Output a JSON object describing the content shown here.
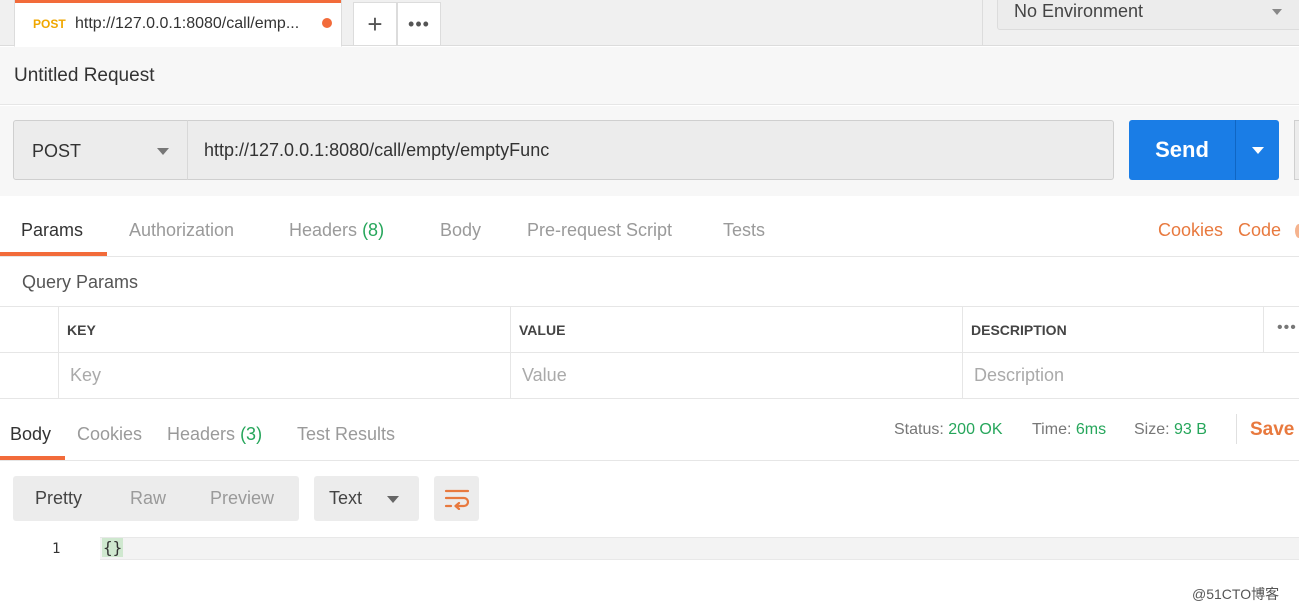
{
  "tab": {
    "method": "POST",
    "url": "http://127.0.0.1:8080/call/emp..."
  },
  "tab_actions": {
    "add_symbol": "+",
    "more_symbol": "•••"
  },
  "environment": {
    "selected": "No Environment"
  },
  "request": {
    "title": "Untitled Request",
    "method": "POST",
    "url": "http://127.0.0.1:8080/call/empty/emptyFunc"
  },
  "send": {
    "label": "Send"
  },
  "request_tabs": {
    "params": "Params",
    "authorization": "Authorization",
    "headers": "Headers",
    "headers_count": "(8)",
    "body": "Body",
    "prerequest": "Pre-request Script",
    "tests": "Tests",
    "cookies": "Cookies",
    "code": "Code"
  },
  "query_params": {
    "title": "Query Params",
    "columns": {
      "key": "KEY",
      "value": "VALUE",
      "description": "DESCRIPTION"
    },
    "placeholders": {
      "key": "Key",
      "value": "Value",
      "description": "Description"
    },
    "more_symbol": "•••"
  },
  "response_tabs": {
    "body": "Body",
    "cookies": "Cookies",
    "headers": "Headers",
    "headers_count": "(3)",
    "test_results": "Test Results"
  },
  "response_meta": {
    "status_label": "Status:",
    "status_value": "200 OK",
    "time_label": "Time:",
    "time_value": "6ms",
    "size_label": "Size:",
    "size_value": "93 B",
    "save_label": "Save R"
  },
  "body_view": {
    "formats": {
      "pretty": "Pretty",
      "raw": "Raw",
      "preview": "Preview"
    },
    "type_selected": "Text"
  },
  "code": {
    "line_number": "1",
    "content": "{}"
  },
  "watermark": "@51CTO博客",
  "colors": {
    "accent": "#f26b3a",
    "send": "#1a7de6",
    "success": "#26a65b",
    "method": "#f0a700"
  }
}
